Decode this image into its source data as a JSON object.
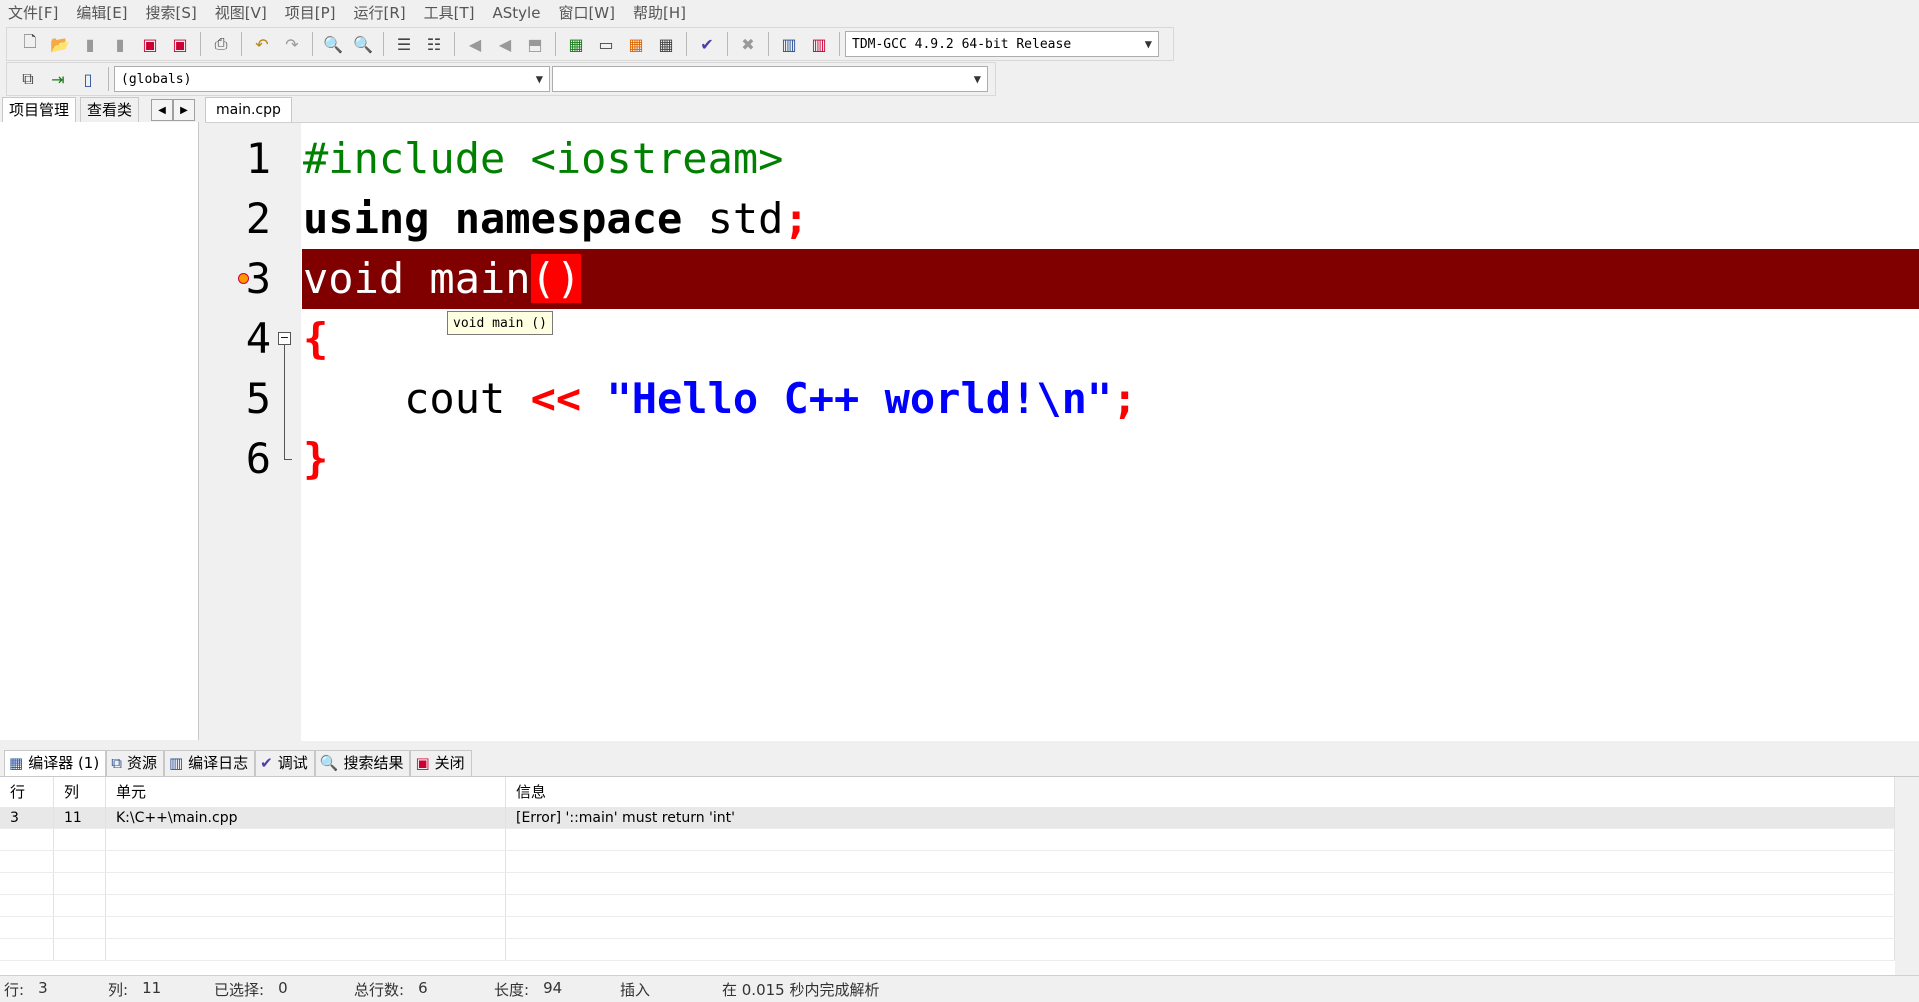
{
  "menu": [
    "文件[F]",
    "编辑[E]",
    "搜索[S]",
    "视图[V]",
    "项目[P]",
    "运行[R]",
    "工具[T]",
    "AStyle",
    "窗口[W]",
    "帮助[H]"
  ],
  "toolbar": {
    "compiler": "TDM-GCC 4.9.2 64-bit Release"
  },
  "toolbar2": {
    "scope": "(globals)",
    "member": ""
  },
  "left_tabs": [
    "项目管理",
    "查看类"
  ],
  "editor_tab": "main.cpp",
  "code": {
    "lines": [
      "1",
      "2",
      "3",
      "4",
      "5",
      "6"
    ],
    "l1": "#include <iostream>",
    "l2_kw": "using namespace",
    "l2_id": " std",
    "l2_semi": ";",
    "l3_text": "void main",
    "l3_paren": "()",
    "l4_brace": "{",
    "l5_indent": "    cout ",
    "l5_op": "<<",
    "l5_str": " \"Hello C++ world!\\n\"",
    "l5_semi": ";",
    "l6_brace": "}"
  },
  "tooltip": "void main ()",
  "bottom_tabs": [
    "编译器 (1)",
    "资源",
    "编译日志",
    "调试",
    "搜索结果",
    "关闭"
  ],
  "grid": {
    "headers": [
      "行",
      "列",
      "单元",
      "信息"
    ],
    "row": {
      "line": "3",
      "col": "11",
      "unit": "K:\\C++\\main.cpp",
      "msg": "[Error] '::main' must return 'int'"
    }
  },
  "status": {
    "row_label": "行:",
    "row": "3",
    "col_label": "列:",
    "col": "11",
    "sel_label": "已选择:",
    "sel": "0",
    "total_label": "总行数:",
    "total": "6",
    "len_label": "长度:",
    "len": "94",
    "mode": "插入",
    "parse": "在 0.015 秒内完成解析"
  }
}
